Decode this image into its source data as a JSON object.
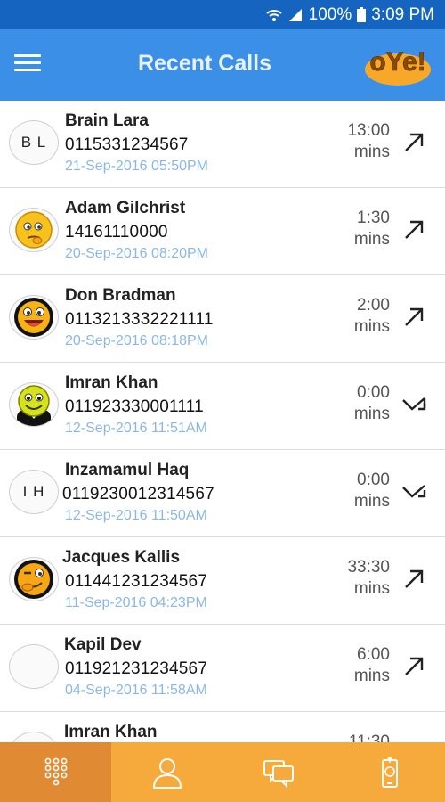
{
  "status_bar": {
    "battery": "100%",
    "time": "3:09 PM",
    "wifi_icon": "wifi-icon",
    "signal_icon": "signal-icon",
    "battery_icon": "battery-icon"
  },
  "header": {
    "title": "Recent Calls",
    "logo_text": "oYe!",
    "menu_icon": "hamburger-menu-icon"
  },
  "calls": [
    {
      "name": "Brain Lara",
      "number": "0115331234567",
      "date": "21-Sep-2016  05:50PM",
      "duration": "13:00",
      "unit": "mins",
      "initials": "B L",
      "direction": "outgoing"
    },
    {
      "name": "Adam Gilchrist",
      "number": "14161110000",
      "date": "20-Sep-2016  08:20PM",
      "duration": "1:30",
      "unit": "mins",
      "initials": "",
      "direction": "outgoing"
    },
    {
      "name": "Don Bradman",
      "number": "0113213332221111",
      "date": "20-Sep-2016  08:18PM",
      "duration": "2:00",
      "unit": "mins",
      "initials": "",
      "direction": "outgoing"
    },
    {
      "name": "Imran Khan",
      "number": "011923330001111",
      "date": "12-Sep-2016  11:51AM",
      "duration": "0:00",
      "unit": "mins",
      "initials": "",
      "direction": "missed"
    },
    {
      "name": "Inzamamul Haq",
      "number": "0119230012314567",
      "date": "12-Sep-2016  11:50AM",
      "duration": "0:00",
      "unit": "mins",
      "initials": "I H",
      "direction": "missed"
    },
    {
      "name": "Jacques Kallis",
      "number": "011441231234567",
      "date": "11-Sep-2016  04:23PM",
      "duration": "33:30",
      "unit": "mins",
      "initials": "",
      "direction": "outgoing"
    },
    {
      "name": "Kapil Dev",
      "number": "011921231234567",
      "date": "04-Sep-2016  11:58AM",
      "duration": "6:00",
      "unit": "mins",
      "initials": "",
      "direction": "outgoing"
    },
    {
      "name": "Imran Khan",
      "number": "",
      "date": "",
      "duration": "11:30",
      "unit": "",
      "initials": "",
      "direction": ""
    }
  ],
  "bottom_nav": [
    {
      "icon": "dialpad-icon",
      "active": true
    },
    {
      "icon": "contacts-icon",
      "active": false
    },
    {
      "icon": "messages-icon",
      "active": false
    },
    {
      "icon": "mobile-topup-icon",
      "active": false
    }
  ],
  "colors": {
    "status_bar": "#1565c0",
    "app_bar": "#3b8fe6",
    "bottom_bar": "#f7aa3c",
    "bottom_bar_active": "#e08a33",
    "date_text": "#8ab8e6"
  }
}
